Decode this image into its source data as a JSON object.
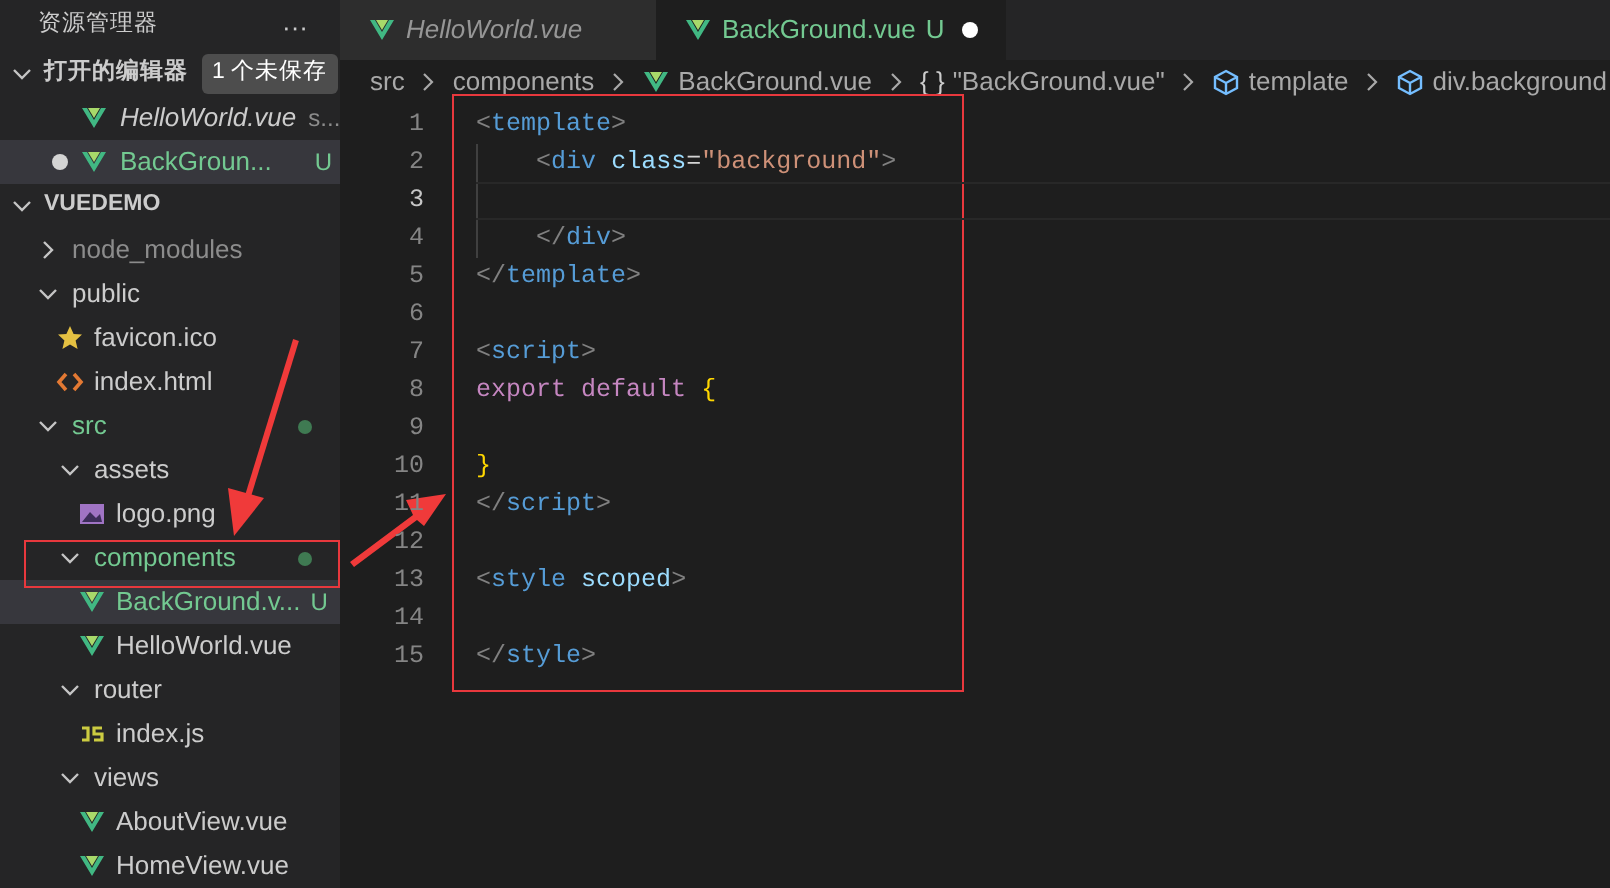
{
  "sidebar": {
    "title": "资源管理器",
    "more": "···",
    "open_editors": {
      "label": "打开的编辑器",
      "expanded": true,
      "badge": "1 个未保存",
      "items": [
        {
          "name": "HelloWorld.vue",
          "italic": true,
          "suffix": "s...",
          "modified": false,
          "selected": false,
          "untracked": false
        },
        {
          "name": "BackGroun...",
          "italic": false,
          "suffix": "U",
          "modified": true,
          "selected": true,
          "untracked": true
        }
      ]
    },
    "project": {
      "label": "VUEDEMO",
      "expanded": true,
      "children": [
        {
          "name": "node_modules",
          "kind": "folder",
          "expanded": false,
          "ignored": true,
          "untracked": false,
          "changes_dot": false,
          "selected": false
        },
        {
          "name": "public",
          "kind": "folder",
          "expanded": true,
          "ignored": false,
          "untracked": false,
          "changes_dot": false,
          "selected": false,
          "children": [
            {
              "name": "favicon.ico",
              "kind": "ico",
              "untracked": false,
              "selected": false
            },
            {
              "name": "index.html",
              "kind": "html",
              "untracked": false,
              "selected": false
            }
          ]
        },
        {
          "name": "src",
          "kind": "folder",
          "expanded": true,
          "ignored": false,
          "untracked": true,
          "changes_dot": true,
          "selected": false,
          "children": [
            {
              "name": "assets",
              "kind": "folder",
              "expanded": true,
              "ignored": false,
              "untracked": false,
              "changes_dot": false,
              "selected": false,
              "children": [
                {
                  "name": "logo.png",
                  "kind": "image",
                  "untracked": false,
                  "selected": false
                }
              ]
            },
            {
              "name": "components",
              "kind": "folder",
              "expanded": true,
              "ignored": false,
              "untracked": true,
              "changes_dot": true,
              "selected": false,
              "children": [
                {
                  "name": "BackGround.v...",
                  "kind": "vue",
                  "untracked": true,
                  "badge": "U",
                  "selected": true
                },
                {
                  "name": "HelloWorld.vue",
                  "kind": "vue",
                  "untracked": false,
                  "selected": false
                }
              ]
            },
            {
              "name": "router",
              "kind": "folder",
              "expanded": true,
              "ignored": false,
              "untracked": false,
              "changes_dot": false,
              "selected": false,
              "children": [
                {
                  "name": "index.js",
                  "kind": "js",
                  "untracked": false,
                  "selected": false
                }
              ]
            },
            {
              "name": "views",
              "kind": "folder",
              "expanded": true,
              "ignored": false,
              "untracked": false,
              "changes_dot": false,
              "selected": false,
              "children": [
                {
                  "name": "AboutView.vue",
                  "kind": "vue",
                  "untracked": false,
                  "selected": false
                },
                {
                  "name": "HomeView.vue",
                  "kind": "vue",
                  "untracked": false,
                  "selected": false
                }
              ]
            }
          ]
        }
      ]
    }
  },
  "tabs": [
    {
      "label": "HelloWorld.vue",
      "italic": true,
      "selected": false,
      "untracked": false,
      "modified": false
    },
    {
      "label": "BackGround.vue",
      "italic": false,
      "selected": true,
      "untracked": true,
      "badge": "U",
      "modified": true
    }
  ],
  "breadcrumb": [
    {
      "label": "src",
      "kind": "folder"
    },
    {
      "label": "components",
      "kind": "folder"
    },
    {
      "label": "BackGround.vue",
      "kind": "vue"
    },
    {
      "label": "\"BackGround.vue\"",
      "kind": "object",
      "symbol": "{ }"
    },
    {
      "label": "template",
      "kind": "element"
    },
    {
      "label": "div.background",
      "kind": "element"
    }
  ],
  "editor": {
    "lines": [
      {
        "number": "1",
        "code": "<template>",
        "current": false
      },
      {
        "number": "2",
        "code": "    <div class=\"background\">",
        "current": false
      },
      {
        "number": "3",
        "current": true
      },
      {
        "number": "4",
        "code": "    </div>",
        "current": false
      },
      {
        "number": "5",
        "code": "</template>",
        "current": false
      },
      {
        "number": "6",
        "current": false
      },
      {
        "number": "7",
        "code": "<script>",
        "current": false
      },
      {
        "number": "8",
        "code": "export default {",
        "current": false
      },
      {
        "number": "9",
        "current": false
      },
      {
        "number": "10",
        "code": "}",
        "current": false
      },
      {
        "number": "11",
        "code": "</script>",
        "current": false
      },
      {
        "number": "12",
        "current": false
      },
      {
        "number": "13",
        "code": "<style scoped>",
        "current": false
      },
      {
        "number": "14",
        "current": false
      },
      {
        "number": "15",
        "code": "</style>",
        "current": false
      }
    ]
  }
}
